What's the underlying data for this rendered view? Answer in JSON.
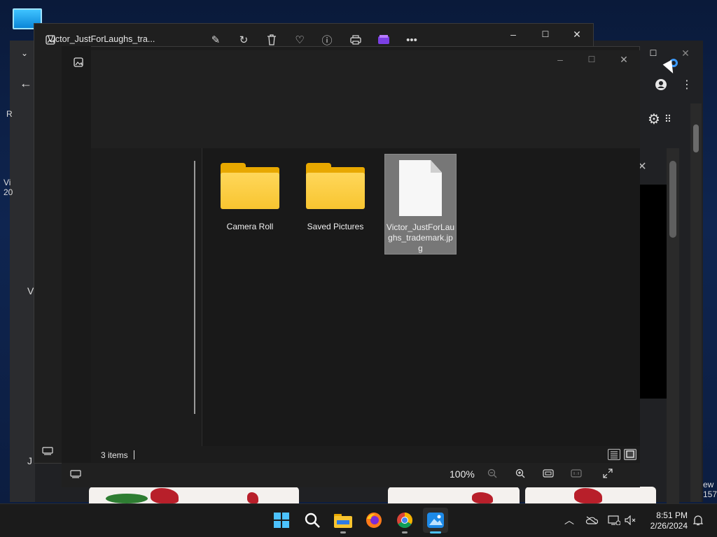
{
  "photos_window": {
    "title": "Victor_JustForLaughs_tra..."
  },
  "folder_view": {
    "items": [
      {
        "label": "Camera Roll",
        "kind": "folder"
      },
      {
        "label": "Saved Pictures",
        "kind": "folder"
      },
      {
        "label": "Victor_JustForLaughs_trademark.jpg",
        "kind": "file",
        "selected": true
      }
    ],
    "status": "3 items"
  },
  "zoom": {
    "value": "100%"
  },
  "background_text": {
    "letter_r": "R",
    "vi": "Vi",
    "num20": "20",
    "v": "V",
    "j": "J",
    "ew": "ew",
    "num157": "157"
  },
  "taskbar": {
    "time": "8:51 PM",
    "date": "2/26/2024"
  },
  "colors": {
    "folder": "#f8c530",
    "accent": "#3d9bff"
  }
}
